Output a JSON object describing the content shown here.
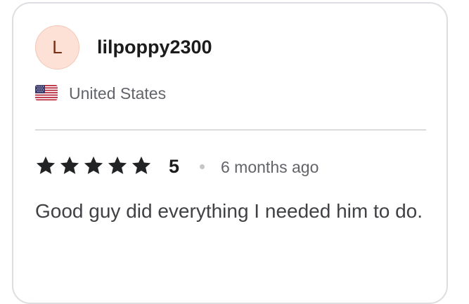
{
  "reviewer": {
    "avatar_initial": "L",
    "username": "lilpoppy2300",
    "country": "United States",
    "flag_icon": "us-flag-icon"
  },
  "review": {
    "stars": 5,
    "rating_text": "5",
    "time_ago": "6 months ago",
    "text": "Good guy did everything I needed him to do."
  },
  "colors": {
    "avatar_bg": "#fde1d6",
    "avatar_text": "#7a2e14",
    "star": "#222325",
    "muted_text": "#62646a",
    "body_text": "#404145",
    "border": "#dedee2"
  }
}
